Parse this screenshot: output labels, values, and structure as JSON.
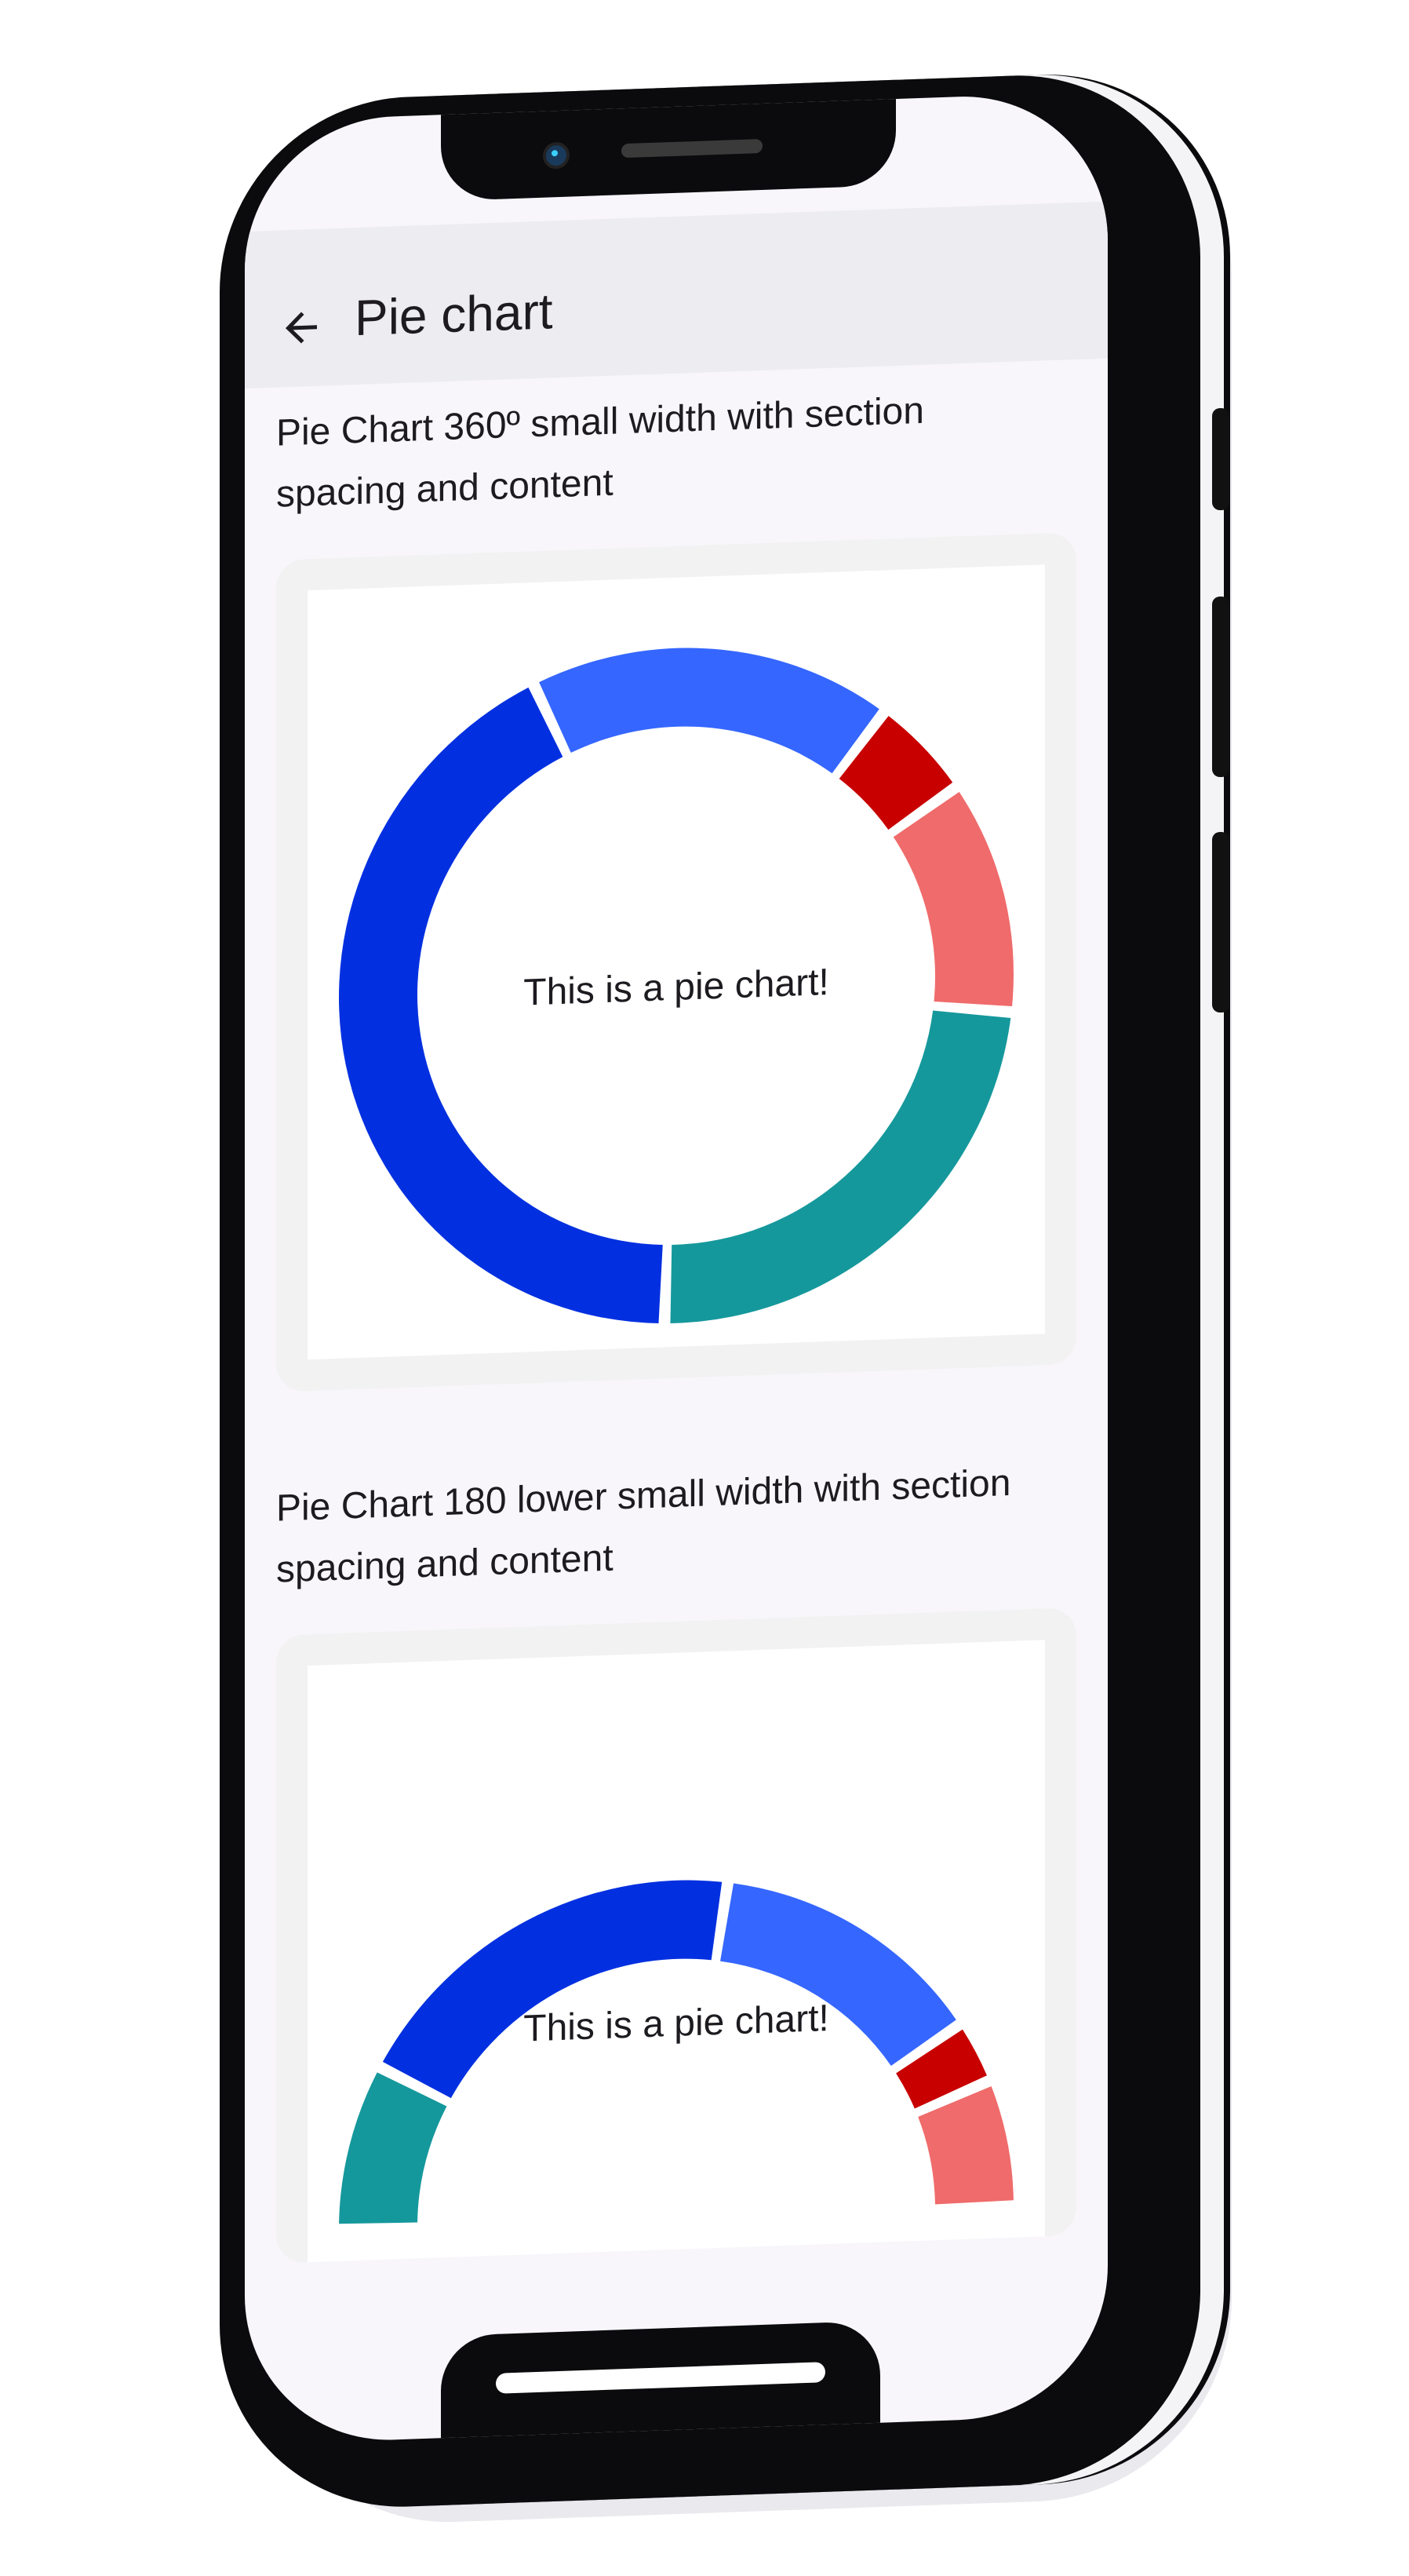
{
  "app": {
    "title": "Pie chart"
  },
  "sections": [
    {
      "title": "Pie Chart 360º small width with section spacing and content",
      "center_text": "This is a pie chart!"
    },
    {
      "title": "Pie Chart 180 lower small width with section spacing and content",
      "center_text": "This is a pie chart!"
    }
  ],
  "colors": {
    "dark_blue": "#0230e0",
    "blue": "#3566ff",
    "red": "#c80000",
    "pink": "#f06b6b",
    "teal": "#15989c",
    "app_bar": "#ececf1",
    "background": "#f8f6fb",
    "card": "#f2f2f2"
  },
  "chart_data": [
    {
      "type": "pie",
      "variant": "donut-360",
      "values": [
        14,
        4,
        9,
        19,
        34
      ],
      "colors": [
        "#3566ff",
        "#c80000",
        "#f06b6b",
        "#15989c",
        "#0230e0"
      ]
    },
    {
      "type": "pie",
      "variant": "donut-180",
      "values": [
        13,
        32,
        22,
        5,
        10
      ],
      "colors": [
        "#15989c",
        "#0230e0",
        "#3566ff",
        "#c80000",
        "#f06b6b"
      ]
    }
  ]
}
